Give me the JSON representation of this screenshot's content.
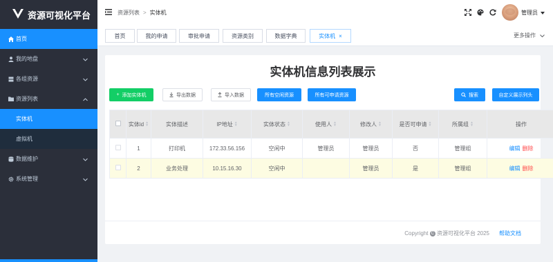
{
  "app": {
    "title": "资源可视化平台"
  },
  "sidebar": {
    "items": [
      {
        "label": "首页",
        "icon": "home-icon",
        "active": true
      },
      {
        "label": "我的地盘",
        "icon": "user-icon",
        "expandable": true
      },
      {
        "label": "各组资源",
        "icon": "server-icon",
        "expandable": true
      },
      {
        "label": "资源列表",
        "icon": "folder-icon",
        "expandable": true,
        "expanded": true
      },
      {
        "label": "实体机",
        "sub": true,
        "active": true
      },
      {
        "label": "虚拟机",
        "sub": true
      },
      {
        "label": "数据维护",
        "icon": "database-icon",
        "expandable": true
      },
      {
        "label": "系统管理",
        "icon": "gear-icon",
        "expandable": true
      }
    ]
  },
  "header": {
    "breadcrumb": [
      "资源列表",
      "实体机"
    ],
    "user": "管理员"
  },
  "tabs": [
    {
      "label": "首页"
    },
    {
      "label": "我的申请"
    },
    {
      "label": "审批申请"
    },
    {
      "label": "资源类别"
    },
    {
      "label": "数据字典"
    },
    {
      "label": "实体机",
      "active": true,
      "closable": true
    }
  ],
  "more_ops": "更多操作",
  "page": {
    "title": "实体机信息列表展示",
    "buttons": {
      "add": "添加实体机",
      "export": "导出数据",
      "import": "导入数据",
      "all_idle": "所有空闲资源",
      "all_applicable": "所有可申请资源",
      "search": "搜索",
      "custom_cols": "自定义展示列头"
    },
    "table": {
      "headers": [
        "实体id",
        "实体描述",
        "IP地址",
        "实体状态",
        "使用人",
        "修改人",
        "是否可申请",
        "所属组",
        "操作"
      ],
      "rows": [
        {
          "id": "1",
          "desc": "打印机",
          "ip": "172.33.56.156",
          "status": "空闲中",
          "user": "管理员",
          "modifier": "管理员",
          "applicable": "否",
          "group": "管理组",
          "highlight": false
        },
        {
          "id": "2",
          "desc": "业务处理",
          "ip": "10.15.16.30",
          "status": "空闲中",
          "user": "",
          "modifier": "管理员",
          "applicable": "是",
          "group": "管理组",
          "highlight": true
        }
      ],
      "ops": {
        "edit": "编辑",
        "delete": "删除"
      }
    }
  },
  "footer": {
    "copyright": "Copyright",
    "copyright_text": "资源可视化平台 2025",
    "help": "帮助文档"
  },
  "colors": {
    "primary": "#1890ff",
    "success": "#13ce66",
    "danger": "#ff4949",
    "sidebar_bg": "#2b2f3a"
  }
}
